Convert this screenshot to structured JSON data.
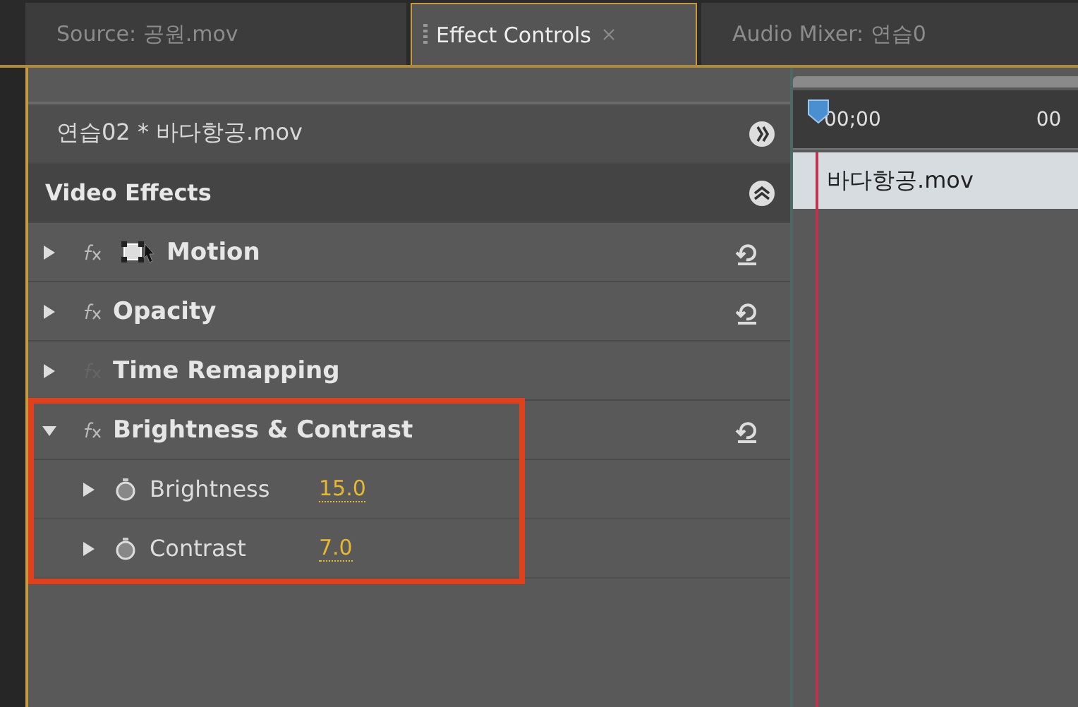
{
  "tabs": [
    {
      "label": "Source: 공원.mov",
      "selected": false,
      "closable": false
    },
    {
      "label": "Effect Controls",
      "selected": true,
      "closable": true
    },
    {
      "label": "Audio Mixer: 연습0",
      "selected": false,
      "closable": false
    }
  ],
  "sequence_header": {
    "label": "연습02 * 바다항공.mov"
  },
  "section": {
    "label": "Video Effects",
    "expanded": true
  },
  "effects": [
    {
      "kind": "effect",
      "name": "Motion",
      "fx_enabled": true,
      "motion_icon": true,
      "expanded": false,
      "highlighted": false,
      "resettable": true
    },
    {
      "kind": "effect",
      "name": "Opacity",
      "fx_enabled": true,
      "motion_icon": false,
      "expanded": false,
      "highlighted": false,
      "resettable": true
    },
    {
      "kind": "effect",
      "name": "Time Remapping",
      "fx_enabled": false,
      "motion_icon": false,
      "expanded": false,
      "highlighted": false,
      "resettable": false
    },
    {
      "kind": "effect",
      "name": "Brightness & Contrast",
      "fx_enabled": true,
      "motion_icon": false,
      "expanded": true,
      "highlighted": true,
      "resettable": true,
      "children": [
        {
          "kind": "param",
          "name": "Brightness",
          "value": "15.0"
        },
        {
          "kind": "param",
          "name": "Contrast",
          "value": "7.0"
        }
      ]
    }
  ],
  "timeline": {
    "ruler_labels": [
      "00;00",
      "00"
    ],
    "clip": "바다항공.mov"
  }
}
